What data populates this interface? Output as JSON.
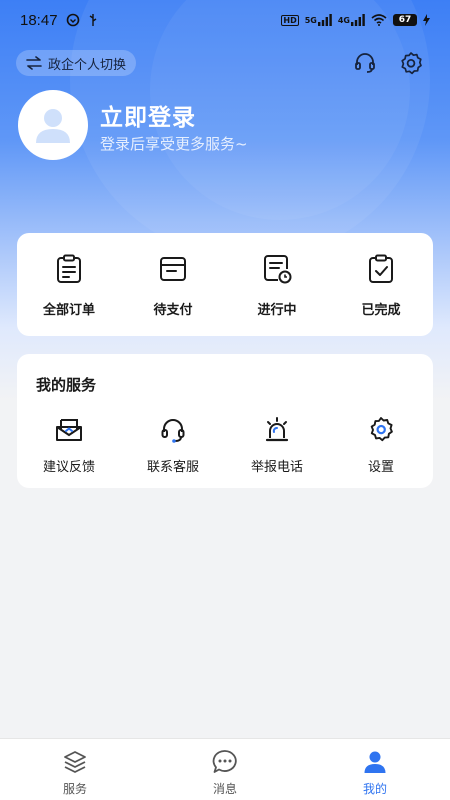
{
  "status_bar": {
    "time": "18:47",
    "network_hd": "HD",
    "network_5g": "5G",
    "network_4g": "4G",
    "battery": "67"
  },
  "header": {
    "switch_label": "政企个人切换",
    "support_icon": "headset-icon",
    "settings_icon": "gear-icon"
  },
  "profile": {
    "title": "立即登录",
    "subtitle": "登录后享受更多服务~"
  },
  "orders": {
    "items": [
      {
        "label": "全部订单",
        "icon": "clipboard-list-icon"
      },
      {
        "label": "待支付",
        "icon": "wallet-icon"
      },
      {
        "label": "进行中",
        "icon": "document-clock-icon"
      },
      {
        "label": "已完成",
        "icon": "clipboard-check-icon"
      }
    ]
  },
  "services": {
    "title": "我的服务",
    "items": [
      {
        "label": "建议反馈",
        "icon": "mailbox-icon"
      },
      {
        "label": "联系客服",
        "icon": "headset-icon"
      },
      {
        "label": "举报电话",
        "icon": "alarm-light-icon"
      },
      {
        "label": "设置",
        "icon": "gear-icon"
      }
    ]
  },
  "bottom_nav": {
    "items": [
      {
        "label": "服务",
        "icon": "layers-icon"
      },
      {
        "label": "消息",
        "icon": "chat-bubble-icon"
      },
      {
        "label": "我的",
        "icon": "person-icon"
      }
    ],
    "active": "我的"
  },
  "colors": {
    "accent": "#2f74f0",
    "hero_top": "#3d7ff5",
    "background": "#f2f3f5"
  }
}
